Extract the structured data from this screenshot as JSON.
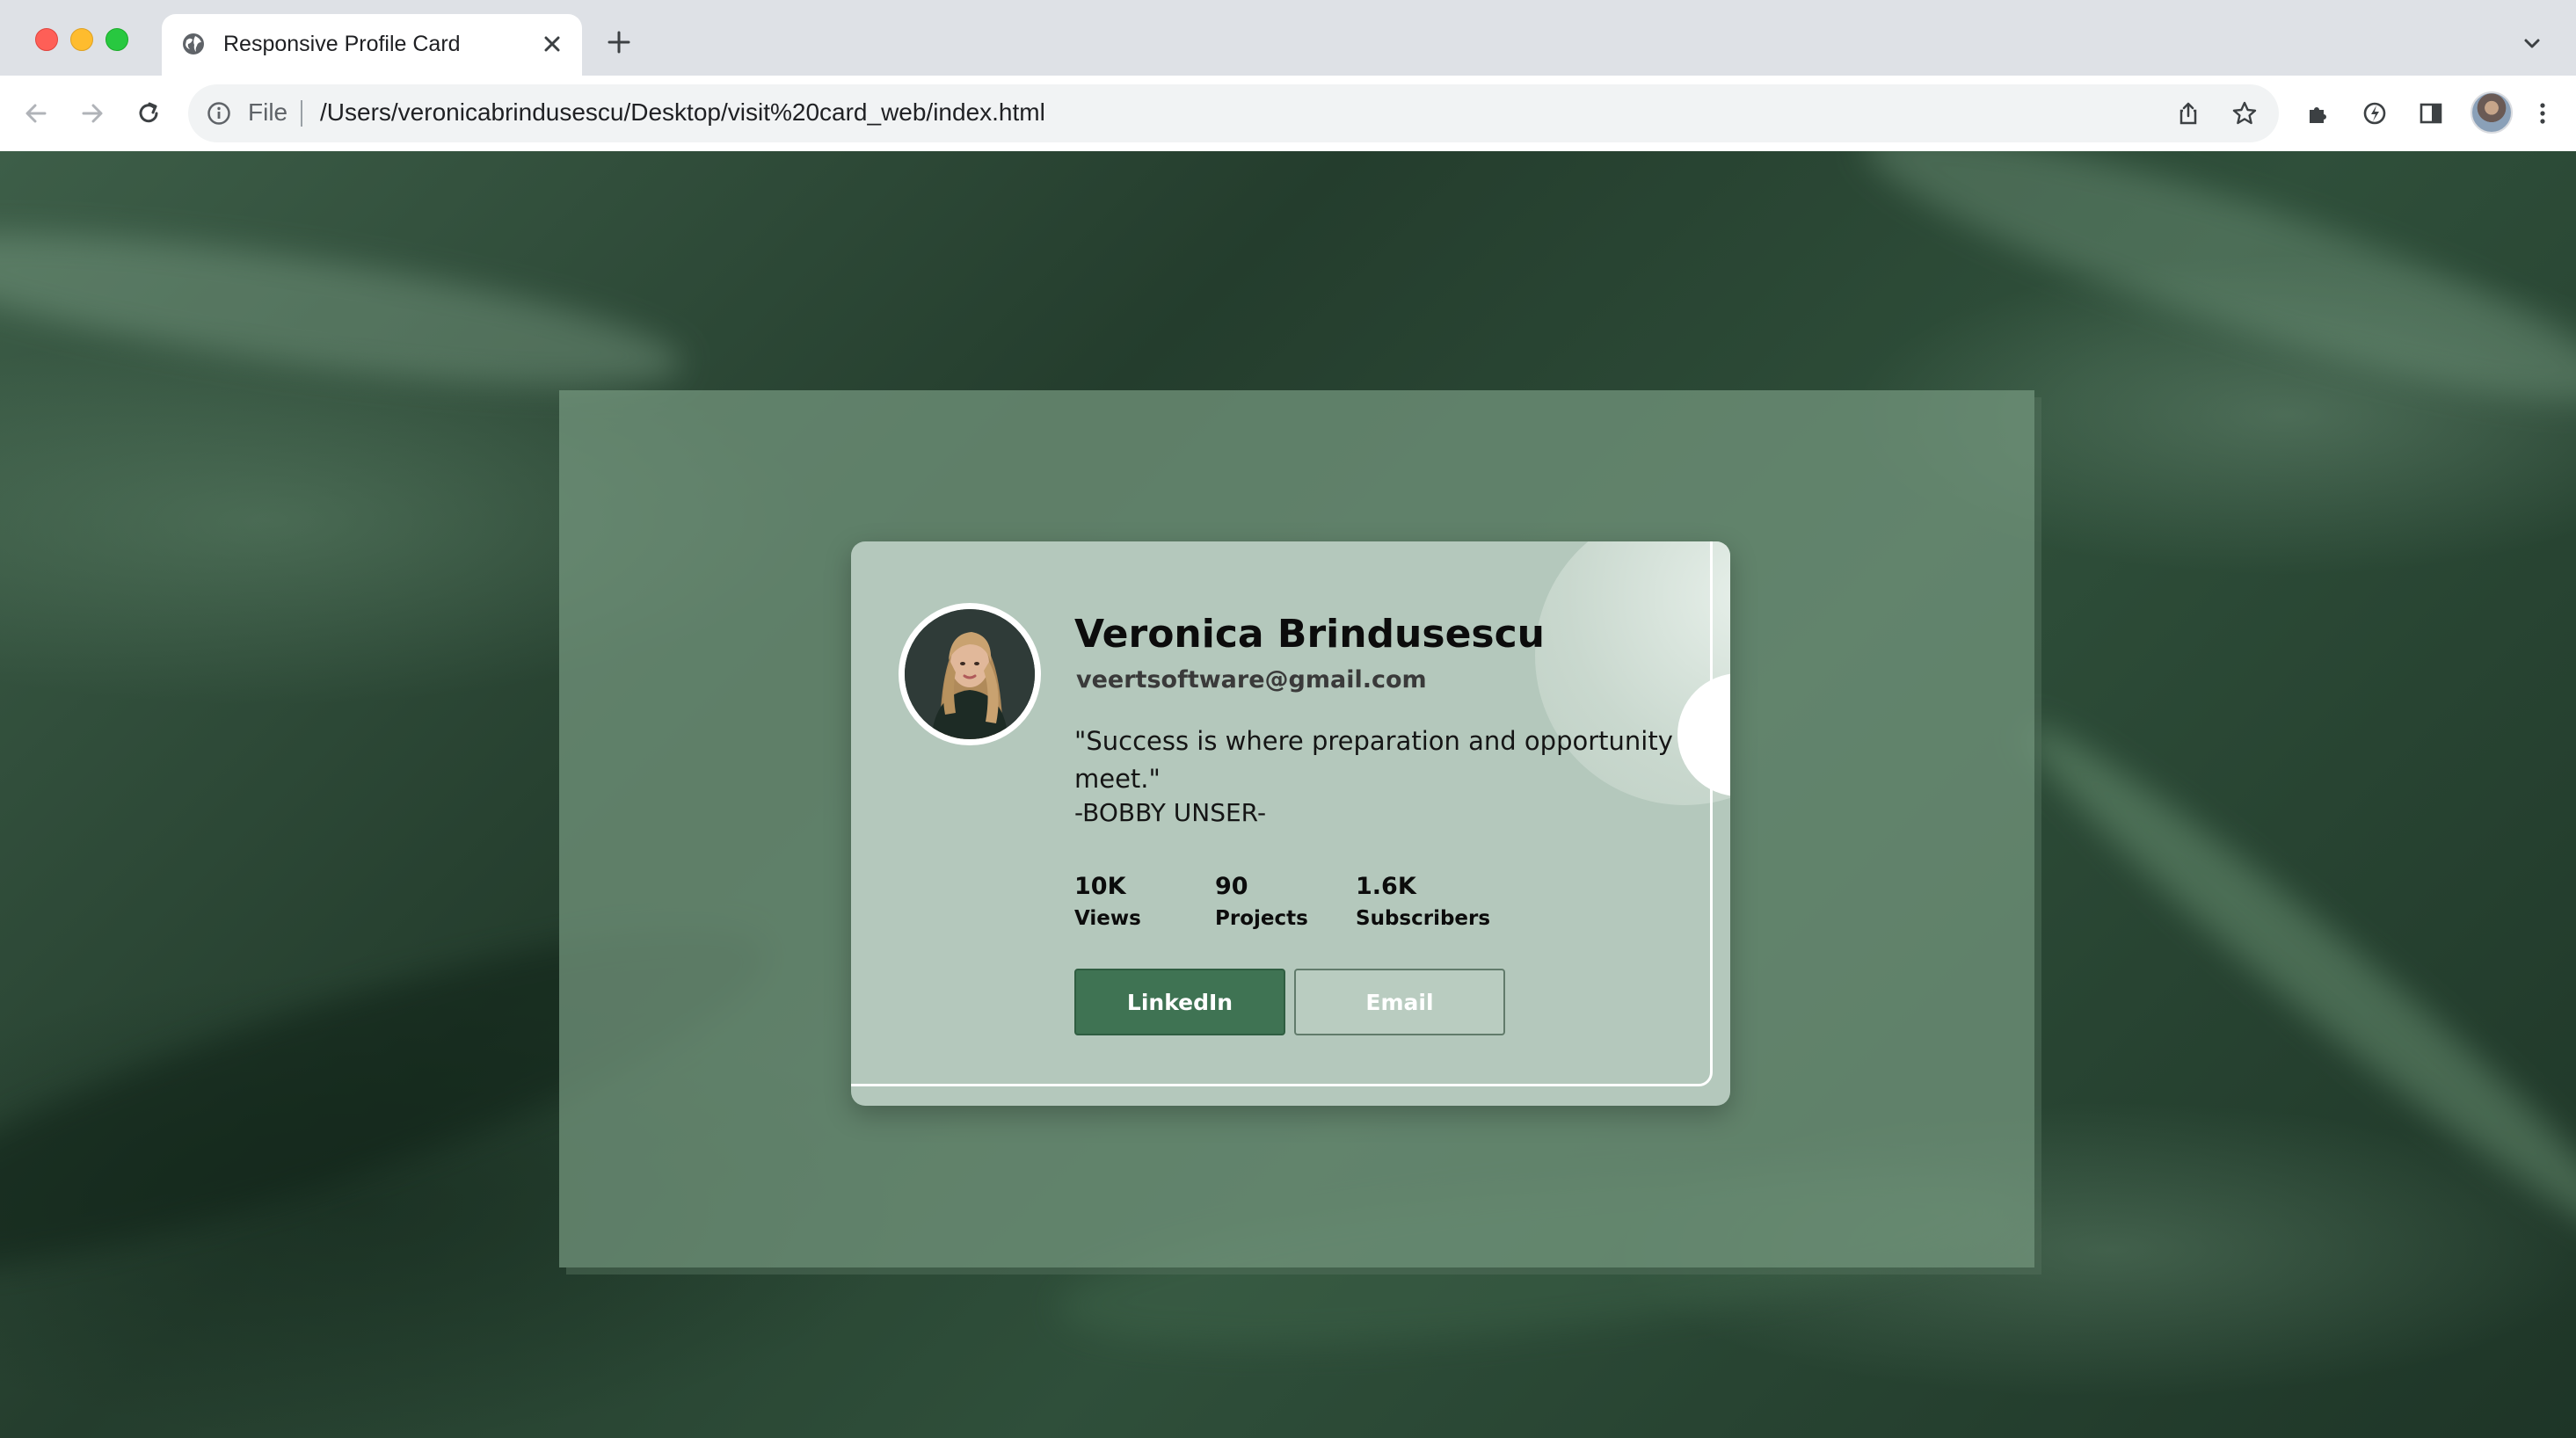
{
  "browser": {
    "tab_title": "Responsive Profile Card",
    "url_scheme": "File",
    "url": "/Users/veronicabrindusescu/Desktop/visit%20card_web/index.html"
  },
  "profile": {
    "name": "Veronica Brindusescu",
    "email": "veertsoftware@gmail.com",
    "quote": "\"Success is where preparation and opportunity meet.\"",
    "author": "-BOBBY UNSER-",
    "stats": [
      {
        "value": "10K",
        "label": "Views"
      },
      {
        "value": "90",
        "label": "Projects"
      },
      {
        "value": "1.6K",
        "label": "Subscribers"
      }
    ],
    "buttons": {
      "primary": "LinkedIn",
      "secondary": "Email"
    }
  },
  "colors": {
    "primary_button": "#3f7353",
    "card_background": "#b4c8bc",
    "frame_overlay": "#769880",
    "page_background": "#2c4636"
  },
  "icons": {
    "tab_favicon": "globe-icon",
    "tab_close": "close-icon",
    "new_tab": "plus-icon",
    "back": "arrow-left-icon",
    "forward": "arrow-right-icon",
    "reload": "reload-icon",
    "site_info": "info-icon",
    "share": "share-icon",
    "bookmark": "star-icon",
    "extensions": "puzzle-icon",
    "performance": "performance-icon",
    "side_panel": "side-panel-icon",
    "menu": "kebab-menu-icon"
  }
}
